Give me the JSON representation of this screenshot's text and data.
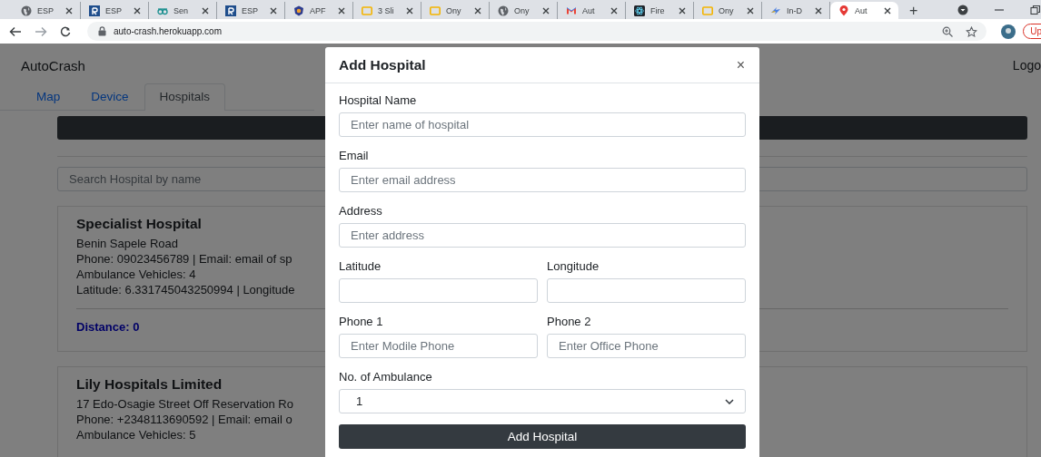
{
  "browser": {
    "tabs": [
      {
        "title": "ESP",
        "kind": "globe",
        "selected": false
      },
      {
        "title": "ESP",
        "kind": "tile",
        "selected": false
      },
      {
        "title": "Sen",
        "kind": "glasses",
        "selected": false
      },
      {
        "title": "ESP",
        "kind": "tile",
        "selected": false
      },
      {
        "title": "APF",
        "kind": "emblem",
        "selected": false
      },
      {
        "title": "3 Sli",
        "kind": "slides",
        "selected": false
      },
      {
        "title": "Ony",
        "kind": "slides",
        "selected": false
      },
      {
        "title": "Ony",
        "kind": "globe",
        "selected": false
      },
      {
        "title": "Aut",
        "kind": "mail",
        "selected": false
      },
      {
        "title": "Fire",
        "kind": "atom",
        "selected": false
      },
      {
        "title": "Ony",
        "kind": "slides",
        "selected": false
      },
      {
        "title": "In-D",
        "kind": "bolt",
        "selected": false
      },
      {
        "title": "Aut",
        "kind": "pin",
        "selected": true
      }
    ],
    "new_tab": "+",
    "url": "auto-crash.herokuapp.com",
    "profile_button": "Up"
  },
  "page": {
    "brand": "AutoCrash",
    "logout": "Logo",
    "nav": [
      {
        "label": "Map",
        "selected": false
      },
      {
        "label": "Device",
        "selected": false
      },
      {
        "label": "Hospitals",
        "selected": true
      }
    ],
    "search": {
      "placeholder": "Search Hospital by name"
    },
    "hospitals": [
      {
        "name": "Specialist Hospital",
        "lines": [
          "Benin Sapele Road",
          "Phone: 09023456789 | Email: email of sp",
          "Ambulance Vehicles: 4",
          "Latitude: 6.331745043250994 | Longitude"
        ],
        "distance": "Distance: 0"
      },
      {
        "name": "Lily Hospitals Limited",
        "lines": [
          "17 Edo-Osagie Street Off Reservation Ro",
          "Phone: +2348113690592 | Email: email o",
          "Ambulance Vehicles: 5"
        ]
      }
    ]
  },
  "modal": {
    "title": "Add Hospital",
    "close": "×",
    "rows": [
      [
        {
          "kind": "input",
          "label": "Hospital Name",
          "placeholder": "Enter name of hospital"
        }
      ],
      [
        {
          "kind": "input",
          "label": "Email",
          "placeholder": "Enter email address"
        }
      ],
      [
        {
          "kind": "input",
          "label": "Address",
          "placeholder": "Enter address"
        }
      ],
      [
        {
          "kind": "input",
          "label": "Latitude"
        },
        {
          "kind": "input",
          "label": "Longitude"
        }
      ],
      [
        {
          "kind": "input",
          "label": "Phone 1",
          "placeholder": "Enter Modile Phone"
        },
        {
          "kind": "input",
          "label": "Phone 2",
          "placeholder": "Enter Office Phone"
        }
      ],
      [
        {
          "kind": "select",
          "label": "No. of Ambulance",
          "value": "1"
        }
      ]
    ],
    "submit": "Add Hospital"
  }
}
